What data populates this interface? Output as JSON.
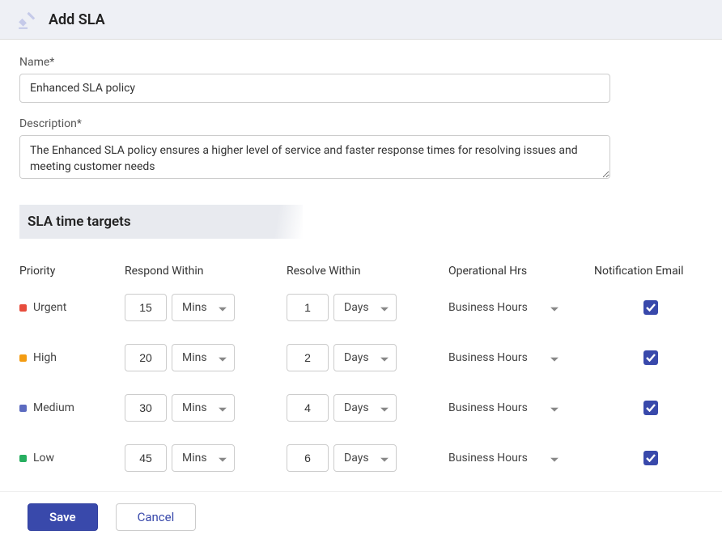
{
  "header": {
    "title": "Add SLA"
  },
  "form": {
    "name_label": "Name*",
    "name_value": "Enhanced SLA policy",
    "description_label": "Description*",
    "description_value": "The Enhanced SLA policy ensures a higher level of service and faster response times for resolving issues and meeting customer needs"
  },
  "section": {
    "title": "SLA time targets"
  },
  "columns": {
    "priority": "Priority",
    "respond": "Respond Within",
    "resolve": "Resolve Within",
    "op_hrs": "Operational Hrs",
    "notify": "Notification Email"
  },
  "rows": [
    {
      "priority": "Urgent",
      "color": "#e74c3c",
      "respond_val": "15",
      "respond_unit": "Mins",
      "resolve_val": "1",
      "resolve_unit": "Days",
      "op_hrs": "Business Hours",
      "notify": true
    },
    {
      "priority": "High",
      "color": "#f39c12",
      "respond_val": "20",
      "respond_unit": "Mins",
      "resolve_val": "2",
      "resolve_unit": "Days",
      "op_hrs": "Business Hours",
      "notify": true
    },
    {
      "priority": "Medium",
      "color": "#5c6bc0",
      "respond_val": "30",
      "respond_unit": "Mins",
      "resolve_val": "4",
      "resolve_unit": "Days",
      "op_hrs": "Business Hours",
      "notify": true
    },
    {
      "priority": "Low",
      "color": "#27ae60",
      "respond_val": "45",
      "respond_unit": "Mins",
      "resolve_val": "6",
      "resolve_unit": "Days",
      "op_hrs": "Business Hours",
      "notify": true
    }
  ],
  "footer": {
    "save": "Save",
    "cancel": "Cancel"
  }
}
